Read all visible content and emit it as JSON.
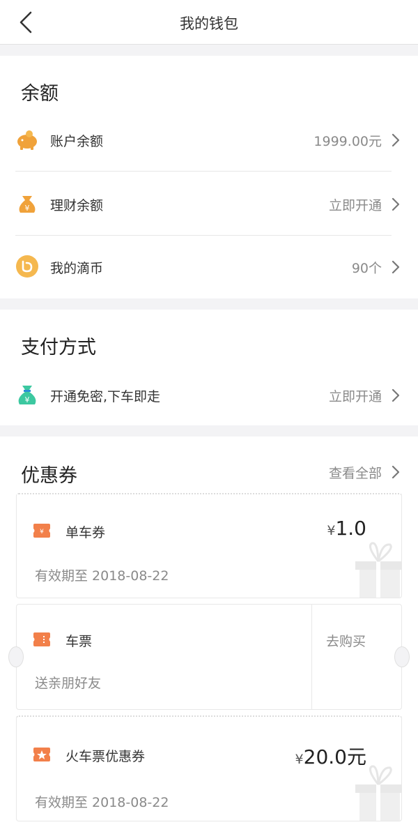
{
  "nav": {
    "title": "我的钱包",
    "back_icon": "chevron-left-icon"
  },
  "balance": {
    "title": "余额",
    "items": [
      {
        "label": "账户余额",
        "value": "1999.00元",
        "icon": "piggy-bank-icon"
      },
      {
        "label": "理财余额",
        "value": "立即开通",
        "icon": "money-bag-icon"
      },
      {
        "label": "我的滴币",
        "value": "90个",
        "icon": "didi-coin-icon"
      }
    ]
  },
  "payment": {
    "title": "支付方式",
    "item": {
      "label": "开通免密,下车即走",
      "value": "立即开通",
      "icon": "money-bag-green-icon"
    }
  },
  "coupons": {
    "title": "优惠券",
    "view_all": "查看全部",
    "items": [
      {
        "name": "单车券",
        "yen": "¥",
        "amount": "1.0",
        "sub": "有效期至 2018-08-22",
        "icon": "ticket-icon"
      },
      {
        "name": "车票",
        "sub": "送亲朋好友",
        "action": "去购买",
        "icon": "ticket-icon"
      },
      {
        "name": "火车票优惠券",
        "yen": "¥",
        "amount": "20.0元",
        "sub": "有效期至 2018-08-22",
        "icon": "star-ticket-icon"
      }
    ]
  },
  "colors": {
    "accent_orange": "#f0a23a",
    "icon_orange": "#f2804a",
    "icon_green": "#3cc8a0",
    "muted": "#8a8a8a"
  }
}
